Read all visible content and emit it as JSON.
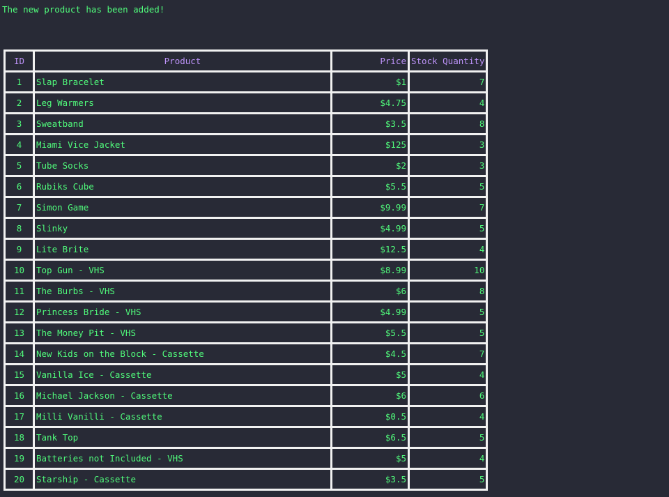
{
  "message": "The new product has been added!",
  "table": {
    "headers": {
      "id": "ID",
      "product": "Product",
      "price": "Price",
      "qty": "Stock Quantity"
    },
    "rows": [
      {
        "id": "1",
        "product": "Slap Bracelet",
        "price": "$1",
        "qty": "7"
      },
      {
        "id": "2",
        "product": "Leg Warmers",
        "price": "$4.75",
        "qty": "4"
      },
      {
        "id": "3",
        "product": "Sweatband",
        "price": "$3.5",
        "qty": "8"
      },
      {
        "id": "4",
        "product": "Miami Vice Jacket",
        "price": "$125",
        "qty": "3"
      },
      {
        "id": "5",
        "product": "Tube Socks",
        "price": "$2",
        "qty": "3"
      },
      {
        "id": "6",
        "product": "Rubiks Cube",
        "price": "$5.5",
        "qty": "5"
      },
      {
        "id": "7",
        "product": "Simon Game",
        "price": "$9.99",
        "qty": "7"
      },
      {
        "id": "8",
        "product": "Slinky",
        "price": "$4.99",
        "qty": "5"
      },
      {
        "id": "9",
        "product": "Lite Brite",
        "price": "$12.5",
        "qty": "4"
      },
      {
        "id": "10",
        "product": "Top Gun - VHS",
        "price": "$8.99",
        "qty": "10"
      },
      {
        "id": "11",
        "product": "The Burbs - VHS",
        "price": "$6",
        "qty": "8"
      },
      {
        "id": "12",
        "product": "Princess Bride - VHS",
        "price": "$4.99",
        "qty": "5"
      },
      {
        "id": "13",
        "product": "The Money Pit - VHS",
        "price": "$5.5",
        "qty": "5"
      },
      {
        "id": "14",
        "product": "New Kids on the Block - Cassette",
        "price": "$4.5",
        "qty": "7"
      },
      {
        "id": "15",
        "product": "Vanilla Ice - Cassette",
        "price": "$5",
        "qty": "4"
      },
      {
        "id": "16",
        "product": "Michael Jackson - Cassette",
        "price": "$6",
        "qty": "6"
      },
      {
        "id": "17",
        "product": "Milli Vanilli - Cassette",
        "price": "$0.5",
        "qty": "4"
      },
      {
        "id": "18",
        "product": "Tank Top",
        "price": "$6.5",
        "qty": "5"
      },
      {
        "id": "19",
        "product": "Batteries not Included - VHS",
        "price": "$5",
        "qty": "4"
      },
      {
        "id": "20",
        "product": "Starship - Cassette",
        "price": "$3.5",
        "qty": "5"
      }
    ]
  },
  "colors": {
    "background": "#282a36",
    "text": "#50fa7b",
    "header_text": "#bd93f9",
    "border": "#f1f1f1"
  }
}
